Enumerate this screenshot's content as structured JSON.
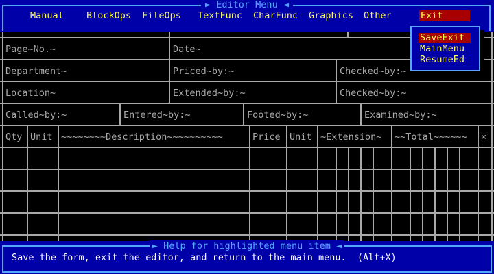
{
  "menu": {
    "title": "Editor Menu",
    "items": [
      "Manual",
      "BlockOps",
      "FileOps",
      "TextFunc",
      "CharFunc",
      "Graphics",
      "Other",
      "Exit"
    ],
    "active": "Exit"
  },
  "exit_menu": {
    "items": [
      "SaveExit",
      "MainMenu",
      "ResumeEd"
    ],
    "highlighted": "SaveExit"
  },
  "form": {
    "row1": [
      "Page~No.~",
      "Date~"
    ],
    "row2": [
      "Department~",
      "Priced~by:~",
      "Checked~by:~"
    ],
    "row3": [
      "Location~",
      "Extended~by:~",
      "Checked~by:~"
    ],
    "row4": [
      "Called~by:~",
      "Entered~by:~",
      "Footed~by:~",
      "Examined~by:~"
    ],
    "columns": [
      "Qty",
      "Unit",
      "~~~~~~~~Description~~~~~~~~~~",
      "Price",
      "Unit",
      "~Extension~",
      "~~Total~~~~~~",
      "×"
    ]
  },
  "help": {
    "title": "Help for highlighted menu item",
    "text": "Save the form, exit the editor, and return to the main menu.  (Alt+X)"
  },
  "colors": {
    "background": "#000000",
    "menu_blue": "#0000a8",
    "frame_cyan": "#54a8fc",
    "text_yellow": "#fcfc54",
    "highlight_red": "#a80000",
    "grid_gray": "#a8a8a8"
  }
}
